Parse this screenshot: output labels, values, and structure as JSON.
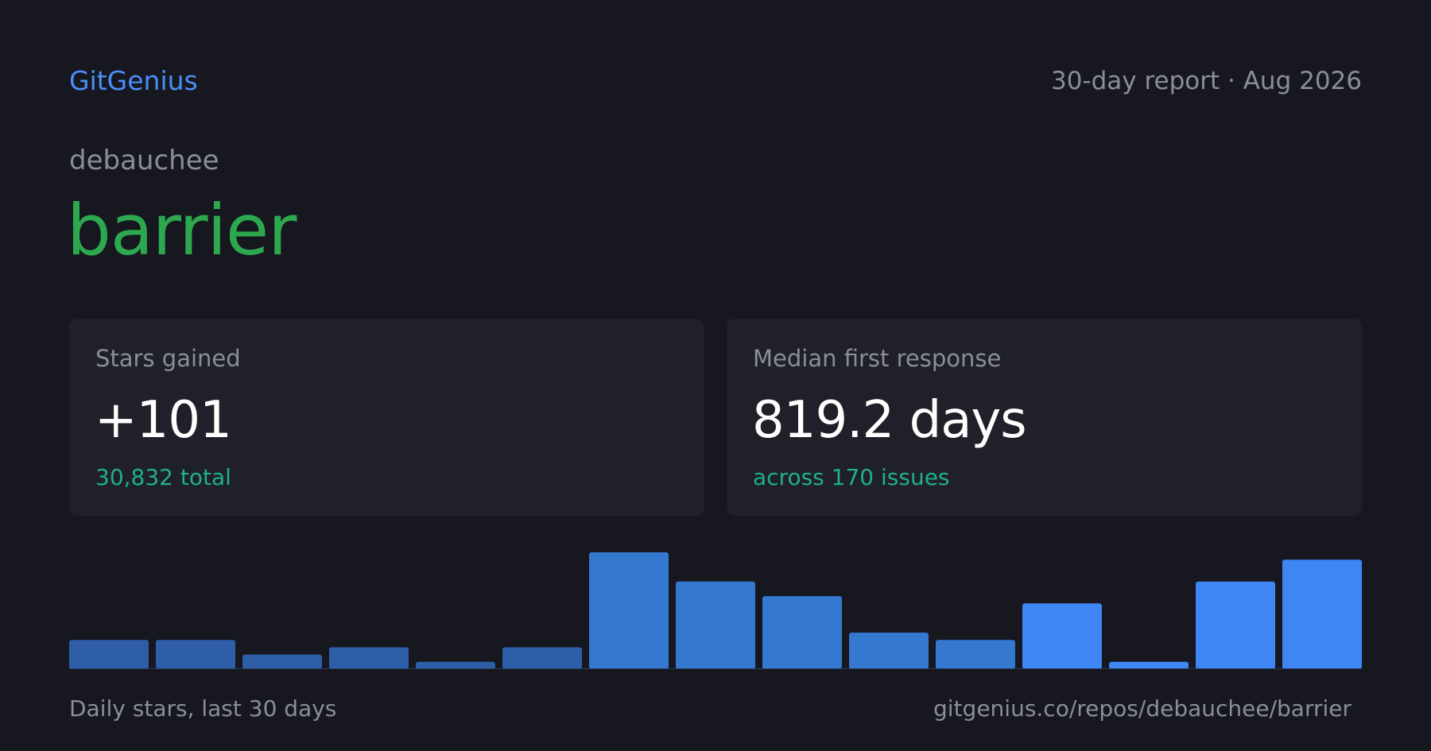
{
  "header": {
    "brand": "GitGenius",
    "report_label": "30-day report · Aug 2026"
  },
  "repo": {
    "owner": "debauchee",
    "name": "barrier"
  },
  "cards": [
    {
      "label": "Stars gained",
      "value": "+101",
      "sub": "30,832 total"
    },
    {
      "label": "Median first response",
      "value": "819.2 days",
      "sub": "across 170 issues"
    }
  ],
  "colors": {
    "background": "#16171f",
    "card": "#1f2029",
    "brand": "#4b8df8",
    "repo_name": "#2ea84f",
    "accent_sub": "#1fb184",
    "muted_text": "#8b8d98",
    "bar_low": "#2f5ea8",
    "bar_mid": "#3578d0",
    "bar_high": "#3f86f5"
  },
  "chart_data": {
    "type": "bar",
    "values": [
      4,
      4,
      2,
      3,
      1,
      3,
      16,
      12,
      10,
      5,
      4,
      9,
      1,
      12,
      15
    ],
    "ylim": [
      0,
      16
    ],
    "grid": false,
    "legend": "none"
  },
  "footer": {
    "caption": "Daily stars, last 30 days",
    "url": "gitgenius.co/repos/debauchee/barrier"
  }
}
